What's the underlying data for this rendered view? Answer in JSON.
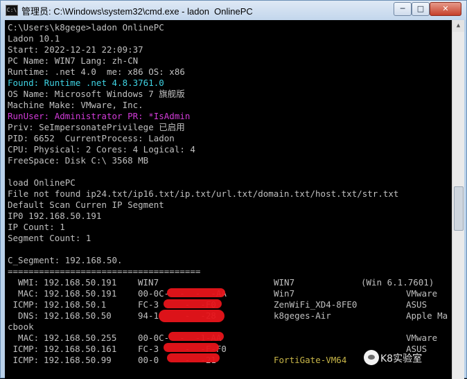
{
  "window": {
    "title": "管理员: C:\\Windows\\system32\\cmd.exe - ladon  OnlinePC",
    "icon_text": "C:\\",
    "controls": {
      "minimize": "─",
      "maximize": "□",
      "close": "✕"
    }
  },
  "console": {
    "lines": [
      "C:\\Users\\k8gege>ladon OnlinePC",
      "Ladon 10.1",
      "Start: 2022-12-21 22:09:37",
      "PC Name: WIN7 Lang: zh-CN",
      "Runtime: .net 4.0  me: x86 OS: x86",
      "Found: Runtime .net 4.8.3761.0",
      "OS Name: Microsoft Windows 7 旗舰版",
      "Machine Make: VMware, Inc.",
      "RunUser: Administrator PR: *IsAdmin",
      "Priv: SeImpersonatePrivilege 已启用",
      "PID: 6652  CurrentProcess: Ladon",
      "CPU: Physical: 2 Cores: 4 Logical: 4",
      "FreeSpace: Disk C:\\ 3568 MB",
      "",
      "load OnlinePC",
      "File not found ip24.txt/ip16.txt/ip.txt/url.txt/domain.txt/host.txt/str.txt",
      "Default Scan Curren IP Segment",
      "IP0 192.168.50.191",
      "IP Count: 1",
      "Segment Count: 1",
      "",
      "C_Segment: 192.168.50.",
      "=====================================",
      "",
      "",
      "",
      "",
      "cbook"
    ],
    "scan_rows": [
      {
        "type": "  WMI:",
        "ip": "192.168.50.191",
        "mac": "WIN7",
        "name": "WIN7",
        "extra": "(Win 6.1.7601)",
        "name_color": "#c0c0c0"
      },
      {
        "type": "  MAC:",
        "ip": "192.168.50.191",
        "mac": "00-0C-  -  -  -AA",
        "name": "Win7",
        "extra": "VMware",
        "name_color": "#c0c0c0"
      },
      {
        "type": " ICMP:",
        "ip": "192.168.50.1",
        "mac": "FC-3     -  -F0",
        "name": "ZenWiFi_XD4-8FE0",
        "extra": "ASUS",
        "name_color": "#c0c0c0"
      },
      {
        "type": "  DNS:",
        "ip": "192.168.50.50",
        "mac": "94-1     -  -28",
        "name": "k8geges-Air",
        "extra": "Apple Ma",
        "name_color": "#c0c0c0"
      },
      {
        "type": "  MAC:",
        "ip": "192.168.50.255",
        "mac": "00-0C-  -  -1-AA",
        "name": "",
        "extra": "VMware",
        "name_color": "#c0c0c0"
      },
      {
        "type": " ICMP:",
        "ip": "192.168.50.161",
        "mac": "FC-3     -  -F-F0",
        "name": "",
        "extra": "ASUS",
        "name_color": "#c0c0c0"
      },
      {
        "type": " ICMP:",
        "ip": "192.168.50.99",
        "mac": "00-0     -  -21",
        "name": "FortiGate-VM64",
        "extra": "",
        "name_color": "#c8b648"
      }
    ]
  },
  "watermark": {
    "text": "K8实验室"
  },
  "colors": {
    "cyan": "#3fd4e4",
    "magenta": "#d23bd8",
    "default_text": "#c0c0c0",
    "redaction": "#e8141a"
  }
}
